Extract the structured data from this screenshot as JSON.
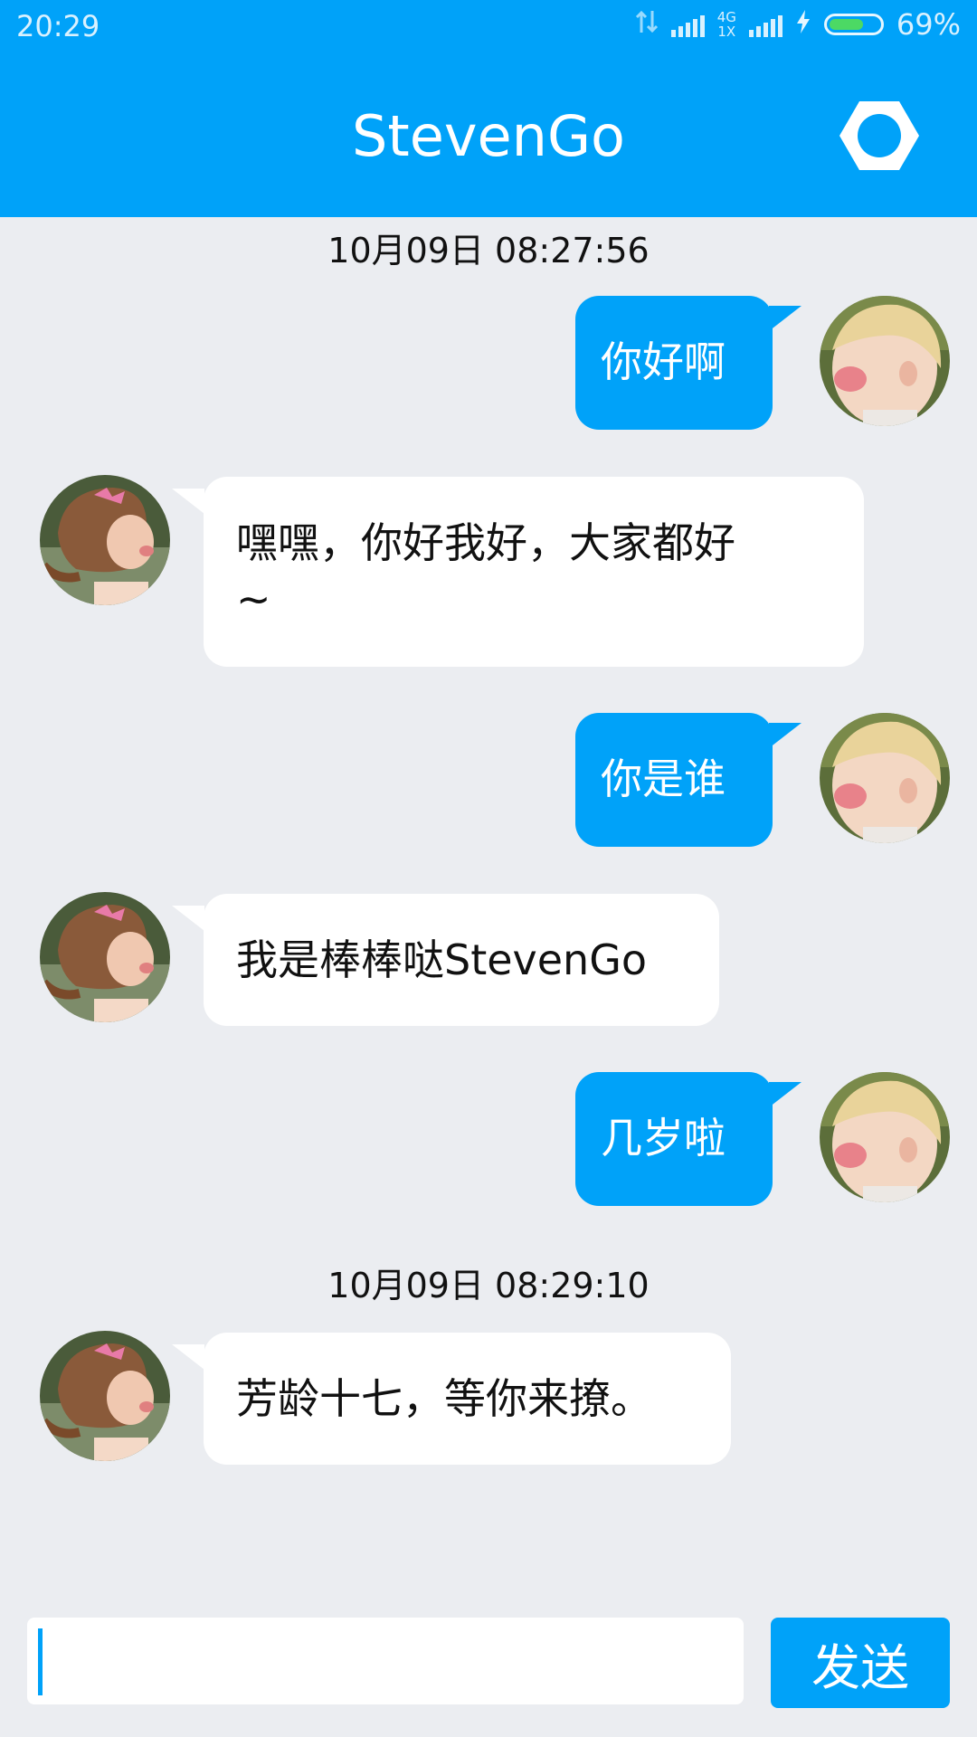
{
  "status_bar": {
    "time": "20:29",
    "net_label_top": "4G",
    "net_label_bottom": "1X",
    "battery_level": 0.69,
    "battery_text": "69%",
    "icons": [
      "data-arrows-icon",
      "signal-icon",
      "signal-icon",
      "charging-bolt-icon",
      "battery-icon"
    ]
  },
  "header": {
    "title": "StevenGo",
    "settings_icon": "hexagon-settings-icon"
  },
  "chat": {
    "timestamps": [
      "10月09日 08:27:56",
      "10月09日 08:29:10"
    ],
    "messages": [
      {
        "from": "me",
        "text": "你好啊"
      },
      {
        "from": "other",
        "text_line1": "嘿嘿，你好我好，大家都好",
        "text_line2": "~"
      },
      {
        "from": "me",
        "text": "你是谁"
      },
      {
        "from": "other",
        "text": "我是棒棒哒StevenGo"
      },
      {
        "from": "me",
        "text": "几岁啦"
      },
      {
        "from": "other",
        "text": "芳龄十七，等你来撩。"
      }
    ]
  },
  "composer": {
    "input_value": "",
    "send_label": "发送"
  },
  "colors": {
    "accent": "#00a2f9",
    "background": "#ebedf1",
    "bubble_other": "#ffffff"
  }
}
